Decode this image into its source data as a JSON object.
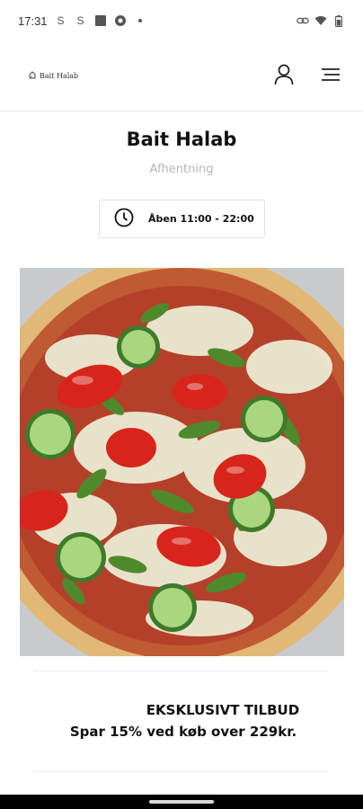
{
  "status_bar": {
    "time": "17:31",
    "left_icons": [
      "s-app-icon",
      "s-app-icon",
      "square-app-icon",
      "settings-icon",
      "dot-icon"
    ],
    "right_icons": [
      "link-icon",
      "wifi-icon",
      "battery-icon"
    ]
  },
  "header": {
    "logo_text": "Bait Halab",
    "icons": [
      "user-icon",
      "menu-icon"
    ]
  },
  "restaurant": {
    "name": "Bait Halab",
    "order_type": "Afhentning",
    "hours": "Åben 11:00 - 22:00"
  },
  "offer": {
    "title": "EKSKLUSIVT TILBUD",
    "text": "Spar 15% ved køb over 229kr."
  },
  "colors": {
    "background": "#ffffff",
    "text": "#111111",
    "muted": "#b5b5b5",
    "border": "#e3e3e3",
    "pizza_crust": "#e2b877",
    "sauce": "#b5402a",
    "tomato": "#d8251b",
    "cucumber": "#8fc36a",
    "arugula": "#4e8a2c"
  }
}
